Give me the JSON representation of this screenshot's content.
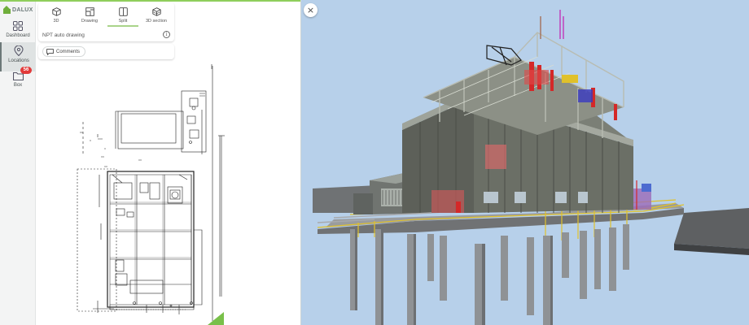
{
  "app": {
    "logo_text": "DALUX",
    "brand_color": "#6fae3b"
  },
  "nav": {
    "items": [
      {
        "label": "Dashboard",
        "icon": "grid-icon"
      },
      {
        "label": "Locations",
        "icon": "location-pin-icon",
        "active": true
      },
      {
        "label": "Box",
        "icon": "folder-icon",
        "badge": "56"
      }
    ]
  },
  "viewer": {
    "tabs": [
      {
        "label": "3D",
        "icon": "cube-icon"
      },
      {
        "label": "Drawing",
        "icon": "drawing-icon"
      },
      {
        "label": "Split",
        "icon": "split-icon",
        "active": true
      },
      {
        "label": "3D section",
        "icon": "section-cube-icon"
      }
    ],
    "drawing_name": "NPT auto drawing",
    "comments_label": "Comments",
    "close_symbol": "×",
    "info_symbol": "i"
  }
}
